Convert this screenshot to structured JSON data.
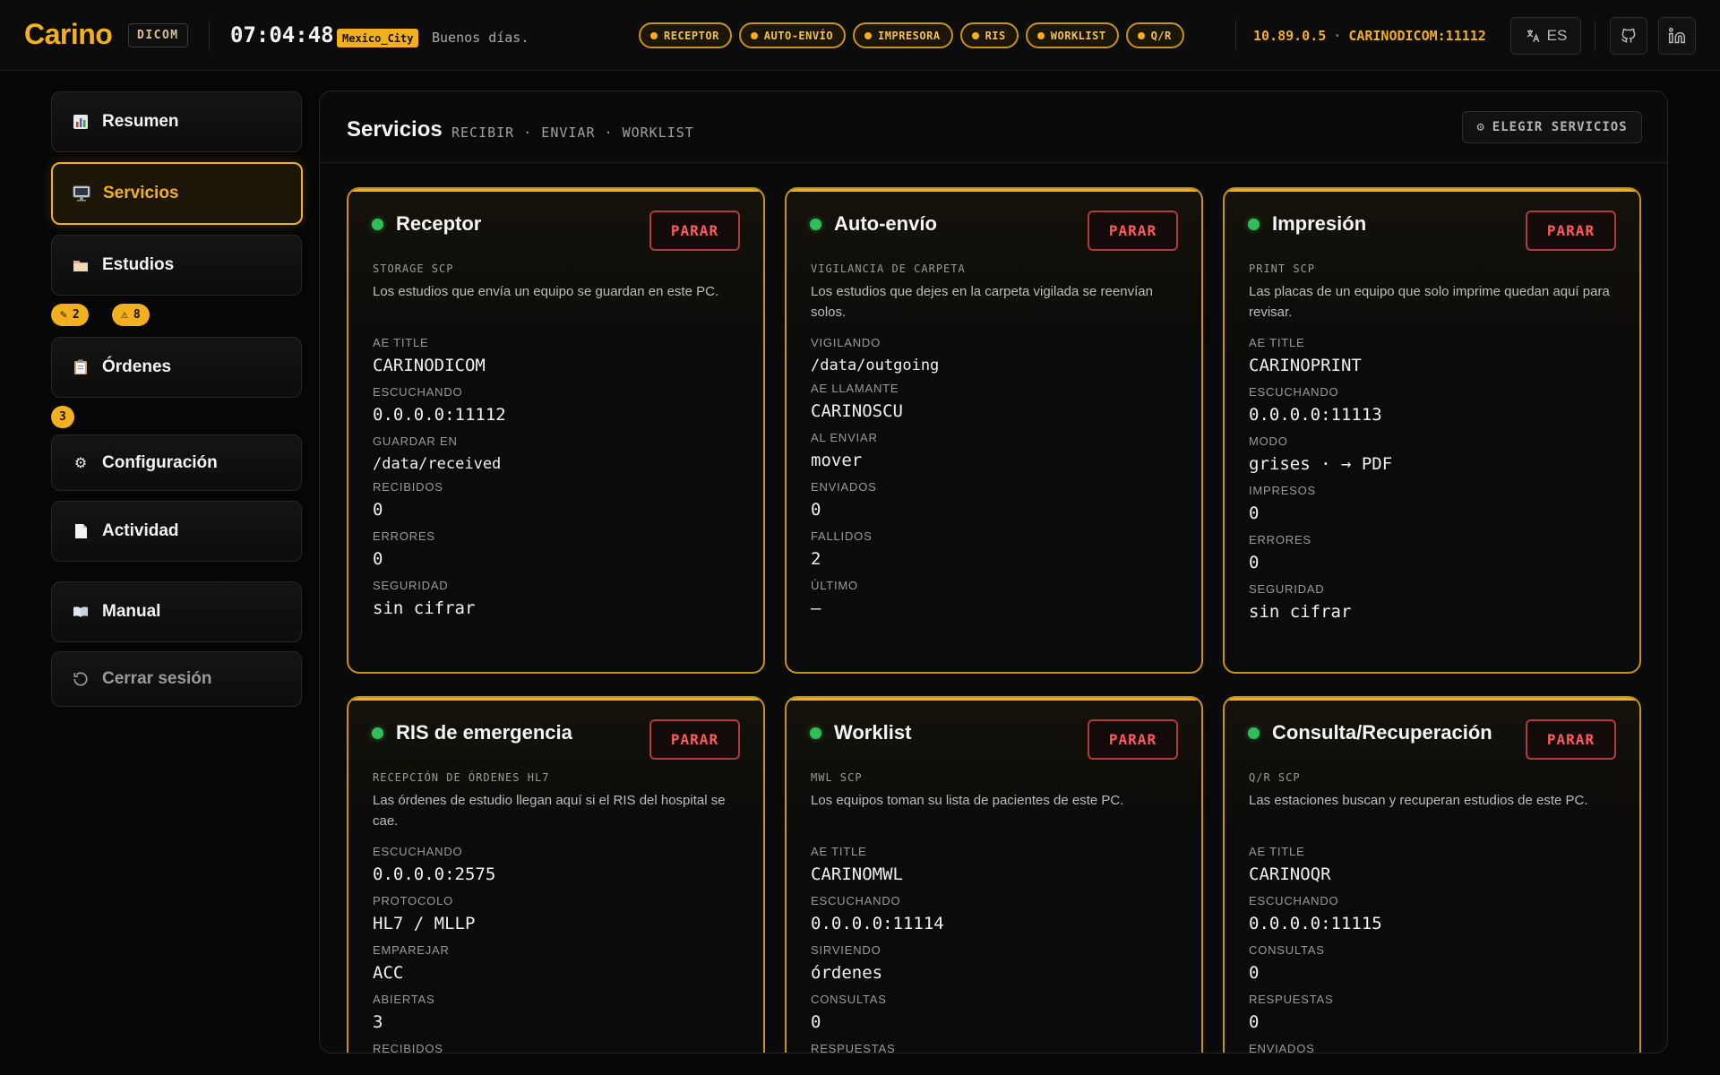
{
  "app": {
    "logo": "Carino",
    "badge": "DICOM",
    "clock": "07:04:48",
    "timezone": "Mexico_City",
    "greeting": "Buenos días.",
    "ip": "10.89.0.5",
    "ae_port": "CARINODICOM:11112",
    "language": "ES",
    "accent_color": "#f2b01e",
    "status_ok_color": "#2fbf59",
    "stop_color": "#ff5a5a"
  },
  "service_pills": [
    "RECEPTOR",
    "AUTO-ENVÍO",
    "IMPRESORA",
    "RIS",
    "WORKLIST",
    "Q/R"
  ],
  "sidebar": {
    "items": [
      {
        "label": "Resumen",
        "icon": "chart-icon"
      },
      {
        "label": "Servicios",
        "icon": "monitor-icon",
        "active": true
      },
      {
        "label": "Estudios",
        "icon": "folder-icon"
      },
      {
        "label": "Órdenes",
        "icon": "clipboard-icon"
      },
      {
        "label": "Configuración",
        "icon": "gear-icon"
      },
      {
        "label": "Actividad",
        "icon": "document-icon"
      },
      {
        "label": "Manual",
        "icon": "book-icon"
      },
      {
        "label": "Cerrar sesión",
        "icon": "logout-icon"
      }
    ],
    "studies_counts": {
      "pending": "2",
      "warnings": "8"
    },
    "orders_count": "3"
  },
  "panel": {
    "title": "Servicios",
    "subtitle": "RECIBIR · ENVIAR · WORKLIST",
    "choose_label": "ELEGIR SERVICIOS"
  },
  "stop_label": "PARAR",
  "cards": [
    {
      "title": "Receptor",
      "kind": "STORAGE SCP",
      "desc": "Los estudios que envía un equipo se guardan en este PC.",
      "fields": [
        {
          "label": "AE TITLE",
          "value": "CARINODICOM"
        },
        {
          "label": "ESCUCHANDO",
          "value": "0.0.0.0:11112"
        },
        {
          "label": "GUARDAR EN",
          "value": "/data/received"
        },
        {
          "label": "RECIBIDOS",
          "value": "0"
        },
        {
          "label": "ERRORES",
          "value": "0"
        },
        {
          "label": "SEGURIDAD",
          "value": "sin cifrar"
        }
      ]
    },
    {
      "title": "Auto-envío",
      "kind": "VIGILANCIA DE CARPETA",
      "desc": "Los estudios que dejes en la carpeta vigilada se reenvían solos.",
      "fields": [
        {
          "label": "VIGILANDO",
          "value": "/data/outgoing"
        },
        {
          "label": "AE LLAMANTE",
          "value": "CARINOSCU"
        },
        {
          "label": "AL ENVIAR",
          "value": "mover"
        },
        {
          "label": "ENVIADOS",
          "value": "0"
        },
        {
          "label": "FALLIDOS",
          "value": "2"
        },
        {
          "label": "ÚLTIMO",
          "value": "—"
        }
      ]
    },
    {
      "title": "Impresión",
      "kind": "PRINT SCP",
      "desc": "Las placas de un equipo que solo imprime quedan aquí para revisar.",
      "fields": [
        {
          "label": "AE TITLE",
          "value": "CARINOPRINT"
        },
        {
          "label": "ESCUCHANDO",
          "value": "0.0.0.0:11113"
        },
        {
          "label": "MODO",
          "value": "grises · → PDF"
        },
        {
          "label": "IMPRESOS",
          "value": "0"
        },
        {
          "label": "ERRORES",
          "value": "0"
        },
        {
          "label": "SEGURIDAD",
          "value": "sin cifrar"
        }
      ]
    },
    {
      "title": "RIS de emergencia",
      "kind": "RECEPCIÓN DE ÓRDENES HL7",
      "desc": "Las órdenes de estudio llegan aquí si el RIS del hospital se cae.",
      "fields": [
        {
          "label": "ESCUCHANDO",
          "value": "0.0.0.0:2575"
        },
        {
          "label": "PROTOCOLO",
          "value": "HL7 / MLLP"
        },
        {
          "label": "EMPAREJAR",
          "value": "ACC"
        },
        {
          "label": "ABIERTAS",
          "value": "3"
        },
        {
          "label": "RECIBIDOS",
          "value": ""
        }
      ]
    },
    {
      "title": "Worklist",
      "kind": "MWL SCP",
      "desc": "Los equipos toman su lista de pacientes de este PC.",
      "fields": [
        {
          "label": "AE TITLE",
          "value": "CARINOMWL"
        },
        {
          "label": "ESCUCHANDO",
          "value": "0.0.0.0:11114"
        },
        {
          "label": "SIRVIENDO",
          "value": "órdenes"
        },
        {
          "label": "CONSULTAS",
          "value": "0"
        },
        {
          "label": "RESPUESTAS",
          "value": ""
        }
      ]
    },
    {
      "title": "Consulta/Recuperación",
      "kind": "Q/R SCP",
      "desc": "Las estaciones buscan y recuperan estudios de este PC.",
      "fields": [
        {
          "label": "AE TITLE",
          "value": "CARINOQR"
        },
        {
          "label": "ESCUCHANDO",
          "value": "0.0.0.0:11115"
        },
        {
          "label": "CONSULTAS",
          "value": "0"
        },
        {
          "label": "RESPUESTAS",
          "value": "0"
        },
        {
          "label": "ENVIADOS",
          "value": ""
        }
      ]
    }
  ]
}
